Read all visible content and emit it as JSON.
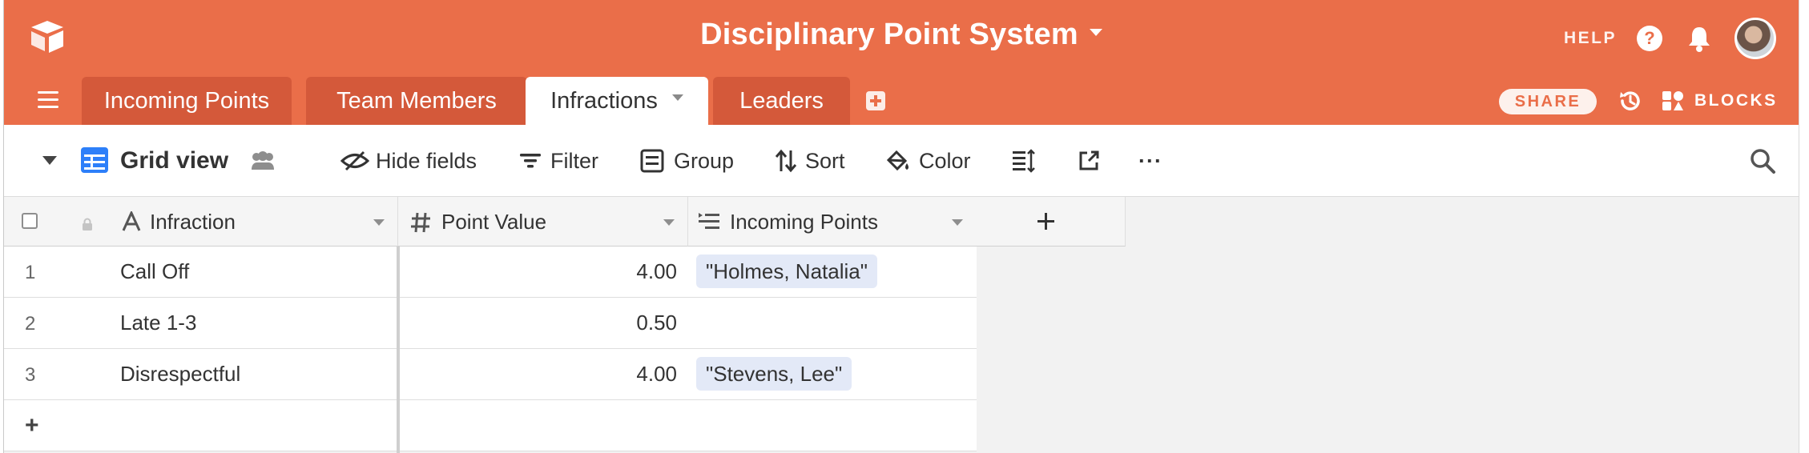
{
  "header": {
    "base_title": "Disciplinary Point System",
    "help_label": "HELP",
    "help_glyph": "?",
    "share_label": "SHARE",
    "blocks_label": "BLOCKS",
    "background": "#ea6e49"
  },
  "tabs": [
    {
      "label": "Incoming Points",
      "active": false
    },
    {
      "label": "Team Members",
      "active": false
    },
    {
      "label": "Infractions",
      "active": true
    },
    {
      "label": "Leaders",
      "active": false
    }
  ],
  "toolbar": {
    "view_name": "Grid view",
    "hide_fields": "Hide fields",
    "filter": "Filter",
    "group": "Group",
    "sort": "Sort",
    "color": "Color",
    "more": "···"
  },
  "grid": {
    "columns": [
      {
        "label": "Infraction",
        "type": "text"
      },
      {
        "label": "Point Value",
        "type": "number"
      },
      {
        "label": "Incoming Points",
        "type": "link"
      }
    ],
    "add_field": "+",
    "add_row": "+",
    "rows": [
      {
        "num": "1",
        "infraction": "Call Off",
        "point_value": "4.00",
        "incoming": "\"Holmes, Natalia\""
      },
      {
        "num": "2",
        "infraction": "Late 1-3",
        "point_value": "0.50",
        "incoming": ""
      },
      {
        "num": "3",
        "infraction": "Disrespectful",
        "point_value": "4.00",
        "incoming": "\"Stevens, Lee\""
      }
    ]
  }
}
